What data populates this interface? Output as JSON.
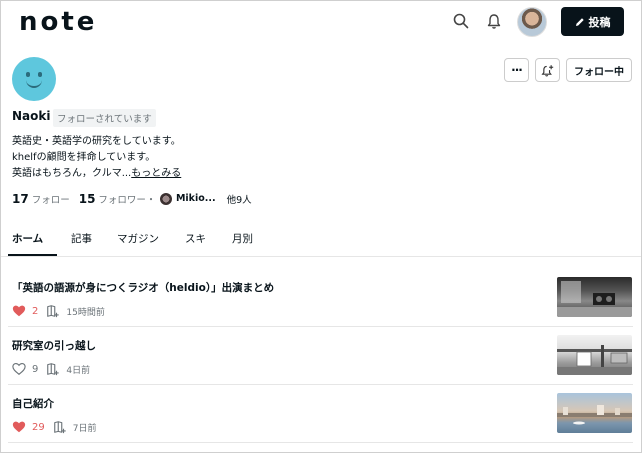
{
  "header": {
    "logo": "note",
    "post_label": "投稿"
  },
  "profile": {
    "name": "Naoki",
    "follows_you": "フォローされています",
    "follow_label": "フォロー中",
    "more_label": "...",
    "bio": {
      "line1": "英語史・英語学の研究をしています。",
      "line2": "khelfの顧問を拝命しています。",
      "line3": "英語はもちろん，クルマ...",
      "more": "もっとみる"
    },
    "stats": {
      "following_count": "17",
      "following_label": "フォロー",
      "followers_count": "15",
      "followers_label": "フォロワー",
      "separator": "・",
      "follower_name": "Mikio...",
      "others": "他9人"
    }
  },
  "tabs": [
    {
      "label": "ホーム"
    },
    {
      "label": "記事"
    },
    {
      "label": "マガジン"
    },
    {
      "label": "スキ"
    },
    {
      "label": "月別"
    }
  ],
  "articles": [
    {
      "title": "「英語の語源が身につくラジオ（heldio）」出演まとめ",
      "likes": "2",
      "liked": true,
      "time": "15時間前"
    },
    {
      "title": "研究室の引っ越し",
      "likes": "9",
      "liked": false,
      "time": "4日前"
    },
    {
      "title": "自己紹介",
      "likes": "29",
      "liked": true,
      "time": "7日前"
    }
  ],
  "colors": {
    "accent": "#08131a",
    "like": "#e15b5b",
    "avatar": "#5ec7dd"
  }
}
